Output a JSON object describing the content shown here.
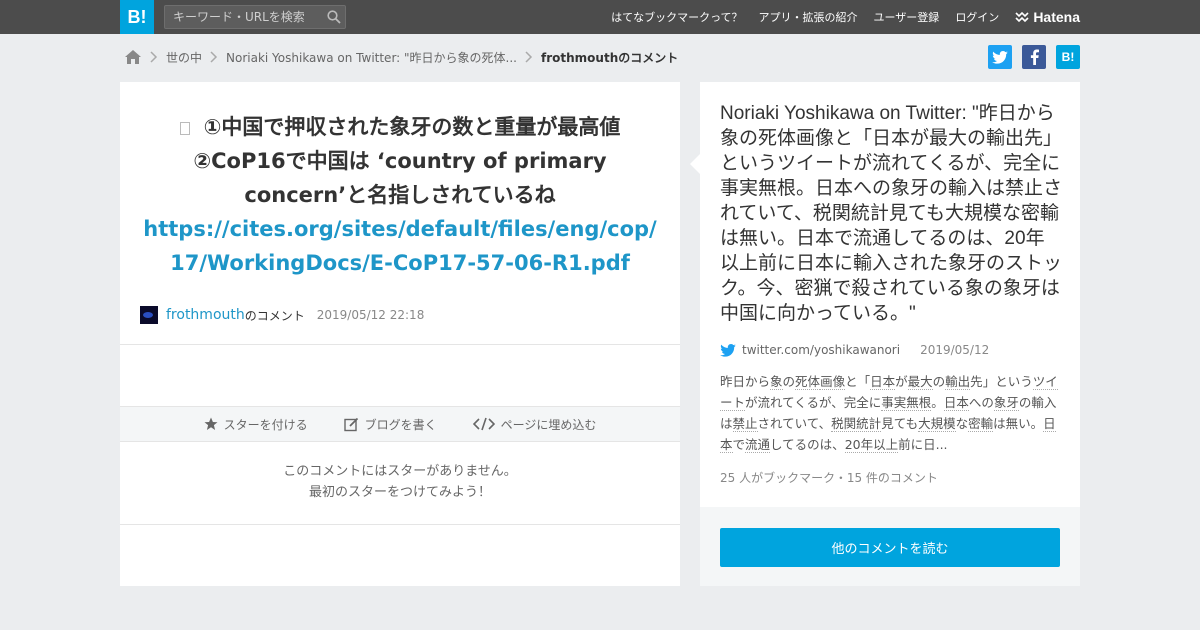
{
  "header": {
    "logo": "B!",
    "search_placeholder": "キーワード・URLを検索",
    "nav": [
      {
        "label": "はてなブックマークって？"
      },
      {
        "label": "アプリ・拡張の紹介"
      },
      {
        "label": "ユーザー登録"
      },
      {
        "label": "ログイン"
      }
    ],
    "brand": "Hatena"
  },
  "breadcrumb": {
    "items": [
      "世の中",
      "Noriaki Yoshikawa on Twitter: \"昨日から象の死体..."
    ],
    "current": "frothmouthのコメント"
  },
  "share": {
    "twitter": "t",
    "facebook": "f",
    "hatena": "B!"
  },
  "comment": {
    "text_line1": "①中国で押収された象牙の数と重量が最高値",
    "text_line2": "②CoP16で中国は ‘country of primary concern’と名指しされているね",
    "link": "https://cites.org/sites/default/files/eng/cop/17/WorkingDocs/E-CoP17-57-06-R1.pdf",
    "user": "frothmouth",
    "user_suffix": "のコメント",
    "date": "2019/05/12 22:18"
  },
  "actions": {
    "star": "スターを付ける",
    "blog": "ブログを書く",
    "embed": "ページに埋め込む"
  },
  "no_star": {
    "line1": "このコメントにはスターがありません。",
    "line2": "最初のスターをつけてみよう！"
  },
  "entry": {
    "title": "Noriaki Yoshikawa on Twitter: \"昨日から象の死体画像と「日本が最大の輸出先」というツイートが流れてくるが、完全に事実無根。日本への象牙の輸入は禁止されていて、税関統計見ても大規模な密輸は無い。日本で流通してるのは、20年以上前に日本に輸入された象牙のストック。今、密猟で殺されている象の象牙は中国に向かっている。\"",
    "source": "twitter.com/yoshikawanori",
    "date": "2019/05/12",
    "summary_parts": [
      "昨日から",
      "象",
      "の",
      "死体",
      "画像",
      "と「",
      "日本",
      "が",
      "最大",
      "の",
      "輸出",
      "先",
      "」という",
      "ツイート",
      "が流れてくるが、完全に",
      "事実無根",
      "。",
      "日本",
      "への",
      "象牙",
      "の輸入は",
      "禁止",
      "されていて、",
      "税関統計",
      "見ても",
      "大規模",
      "な",
      "密輸",
      "は無い。",
      "日本",
      "で",
      "流通",
      "してるのは、",
      "20年以上",
      "前に日..."
    ],
    "stats": "25 人がブックマーク・15 件のコメント",
    "read_more": "他のコメントを読む"
  },
  "colors": {
    "topbar": "#4c4c4c",
    "accent": "#00a4de",
    "link": "#1e96c8",
    "page_bg": "#ebedef"
  }
}
